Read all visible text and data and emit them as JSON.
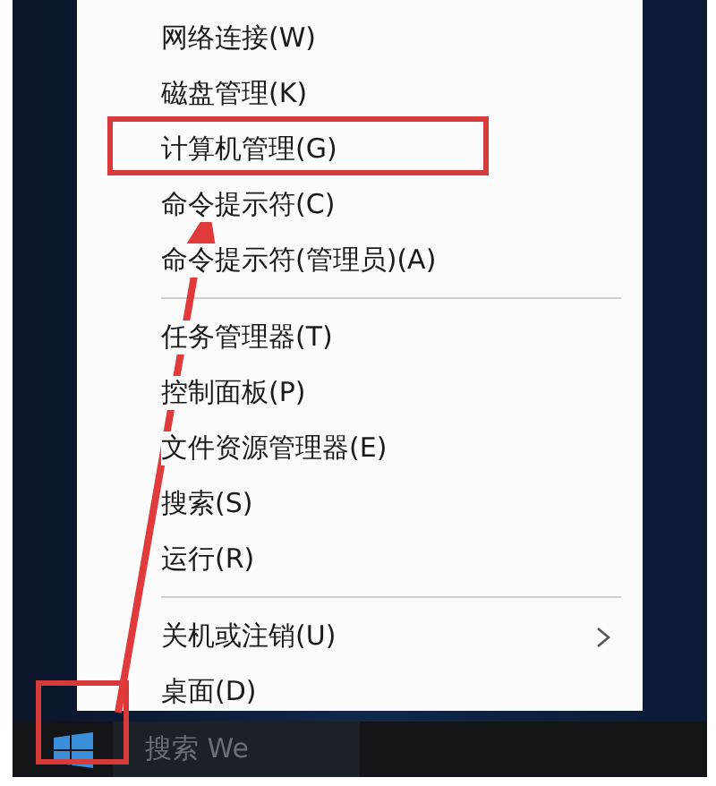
{
  "menu": {
    "items": [
      {
        "kind": "item",
        "label": "网络连接(W)",
        "submenu": false,
        "annotated": false
      },
      {
        "kind": "item",
        "label": "磁盘管理(K)",
        "submenu": false,
        "annotated": false
      },
      {
        "kind": "item",
        "label": "计算机管理(G)",
        "submenu": false,
        "annotated": true
      },
      {
        "kind": "item",
        "label": "命令提示符(C)",
        "submenu": false,
        "annotated": false
      },
      {
        "kind": "item",
        "label": "命令提示符(管理员)(A)",
        "submenu": false,
        "annotated": false
      },
      {
        "kind": "separator"
      },
      {
        "kind": "item",
        "label": "任务管理器(T)",
        "submenu": false,
        "annotated": false
      },
      {
        "kind": "item",
        "label": "控制面板(P)",
        "submenu": false,
        "annotated": false
      },
      {
        "kind": "item",
        "label": "文件资源管理器(E)",
        "submenu": false,
        "annotated": false
      },
      {
        "kind": "item",
        "label": "搜索(S)",
        "submenu": false,
        "annotated": false
      },
      {
        "kind": "item",
        "label": "运行(R)",
        "submenu": false,
        "annotated": false
      },
      {
        "kind": "separator"
      },
      {
        "kind": "item",
        "label": "关机或注销(U)",
        "submenu": true,
        "annotated": false
      },
      {
        "kind": "item",
        "label": "桌面(D)",
        "submenu": false,
        "annotated": false
      }
    ]
  },
  "taskbar": {
    "start_button": {
      "annotated": true
    },
    "search": {
      "placeholder": "搜索 We"
    }
  },
  "callout_arrow": true
}
